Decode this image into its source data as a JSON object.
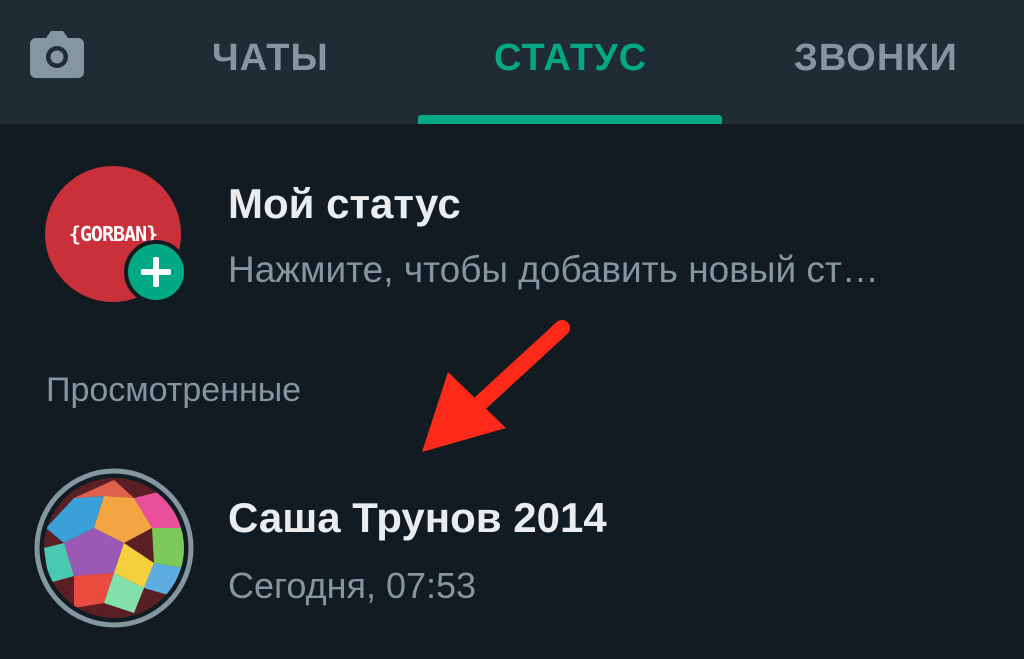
{
  "tabs": {
    "camera_icon": "camera-icon",
    "chats": "ЧАТЫ",
    "status": "СТАТУС",
    "calls": "ЗВОНКИ",
    "active": "status",
    "accent_color": "#00a884"
  },
  "my_status": {
    "avatar_logo_text": "{GORBAN}",
    "title": "Мой статус",
    "subtitle": "Нажмите, чтобы добавить новый ст…"
  },
  "viewed": {
    "header": "Просмотренные",
    "items": [
      {
        "name": "Саша Трунов 2014",
        "time": "Сегодня, 07:53"
      }
    ]
  },
  "colors": {
    "background": "#121b22",
    "tabbar": "#1f2c34",
    "primary_text": "#e9edef",
    "secondary_text": "#8696a0",
    "annotation_arrow": "#ff2a1a"
  }
}
